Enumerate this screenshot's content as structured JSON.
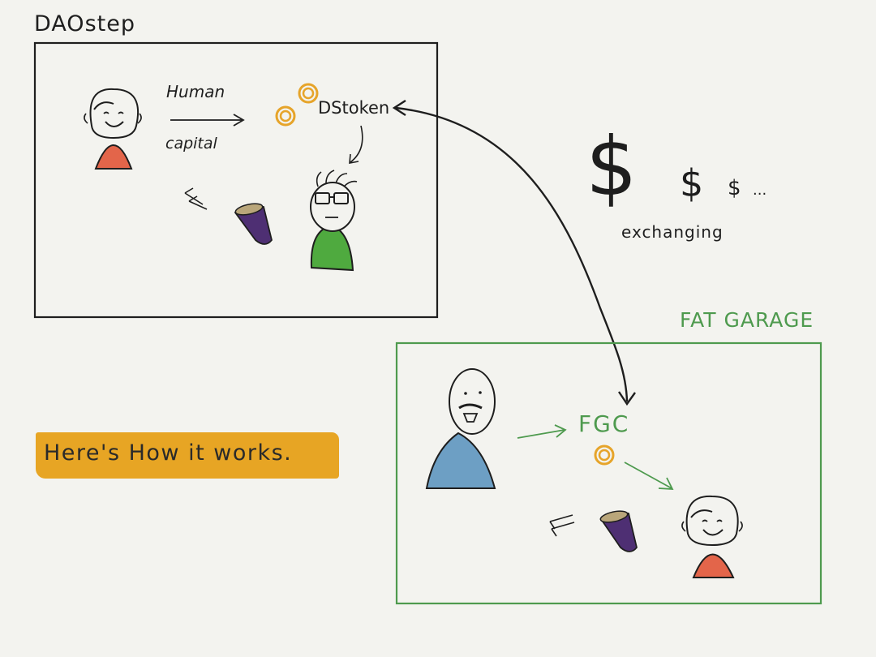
{
  "daostep": {
    "title": "DAOstep",
    "arrow_top_label": "Human",
    "arrow_bottom_label": "capital",
    "token_label": "DStoken"
  },
  "exchange": {
    "dollar_big": "$",
    "dollar_mid": "$",
    "dollar_small": "$",
    "ellipsis": "...",
    "label": "exchanging"
  },
  "fat_garage": {
    "title": "FAT GARAGE",
    "token_label": "FGC"
  },
  "banner": {
    "text": "Here's How it works."
  },
  "colors": {
    "ink": "#1e1e1e",
    "green_frame": "#4e9a4e",
    "coin": "#e6a42a",
    "orange_body": "#e3654a",
    "green_body": "#4faa3f",
    "blue_body": "#6d9fc4",
    "cup": "#4e2f73",
    "banner": "#e7a524",
    "background": "#f3f3ef"
  }
}
